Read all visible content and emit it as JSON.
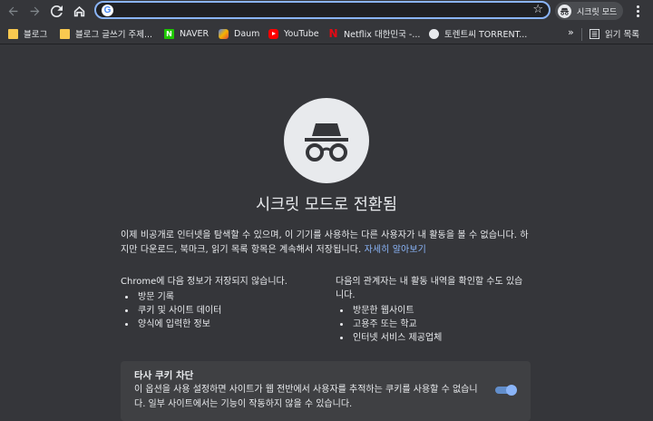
{
  "toolbar": {
    "omnibox_value": "",
    "profile_label": "시크릿 모드"
  },
  "bookmarks": [
    {
      "label": "블로그",
      "icon": "folder-icon"
    },
    {
      "label": "블로그 글쓰기 주제...",
      "icon": "folder-icon"
    },
    {
      "label": "NAVER",
      "icon": "naver-icon"
    },
    {
      "label": "Daum",
      "icon": "daum-icon"
    },
    {
      "label": "YouTube",
      "icon": "youtube-icon"
    },
    {
      "label": "Netflix 대한민국 -...",
      "icon": "netflix-icon"
    },
    {
      "label": "토렌트씨 TORRENT...",
      "icon": "globe-icon"
    }
  ],
  "bookmarks_more": "»",
  "reading_list_label": "읽기 목록",
  "main": {
    "title": "시크릿 모드로 전환됨",
    "intro": "이제 비공개로 인터넷을 탐색할 수 있으며, 이 기기를 사용하는 다른 사용자가 내 활동을 볼 수 없습니다. 하지만 다운로드, 북마크, 읽기 목록 항목은 계속해서 저장됩니다.",
    "learn_more": "자세히 알아보기",
    "left_column": {
      "heading": "Chrome에 다음 정보가 저장되지 않습니다.",
      "items": [
        "방문 기록",
        "쿠키 및 사이트 데이터",
        "양식에 입력한 정보"
      ]
    },
    "right_column": {
      "heading": "다음의 관계자는 내 활동 내역을 확인할 수도 있습니다.",
      "items": [
        "방문한 웹사이트",
        "고용주 또는 학교",
        "인터넷 서비스 제공업체"
      ]
    },
    "cookie_card": {
      "title": "타사 쿠키 차단",
      "description": "이 옵션을 사용 설정하면 사이트가 웹 전반에서 사용자를 추적하는 쿠키를 사용할 수 없습니다. 일부 사이트에서는 기능이 작동하지 않을 수 있습니다.",
      "toggle_on": true
    }
  },
  "colors": {
    "background": "#35363a",
    "accent": "#8ab4f8",
    "card": "#3f4043"
  }
}
